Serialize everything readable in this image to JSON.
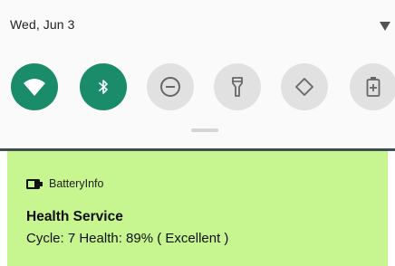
{
  "status_bar": {
    "date": "Wed, Jun 3"
  },
  "quick_settings": {
    "tiles": [
      {
        "icon": "wifi-icon",
        "state": "on"
      },
      {
        "icon": "bluetooth-icon",
        "state": "on"
      },
      {
        "icon": "do-not-disturb-icon",
        "state": "off"
      },
      {
        "icon": "flashlight-icon",
        "state": "off"
      },
      {
        "icon": "auto-rotate-icon",
        "state": "off"
      },
      {
        "icon": "battery-saver-icon",
        "state": "off"
      }
    ],
    "active_color": "#1a8c6a",
    "inactive_color": "#e1e1e1"
  },
  "notification": {
    "app_icon": "battery-icon",
    "app_name": "BatteryInfo",
    "title": "Health Service",
    "text": "Cycle: 7  Health: 89%  ( Excellent )",
    "background_color": "#c7f58f"
  }
}
